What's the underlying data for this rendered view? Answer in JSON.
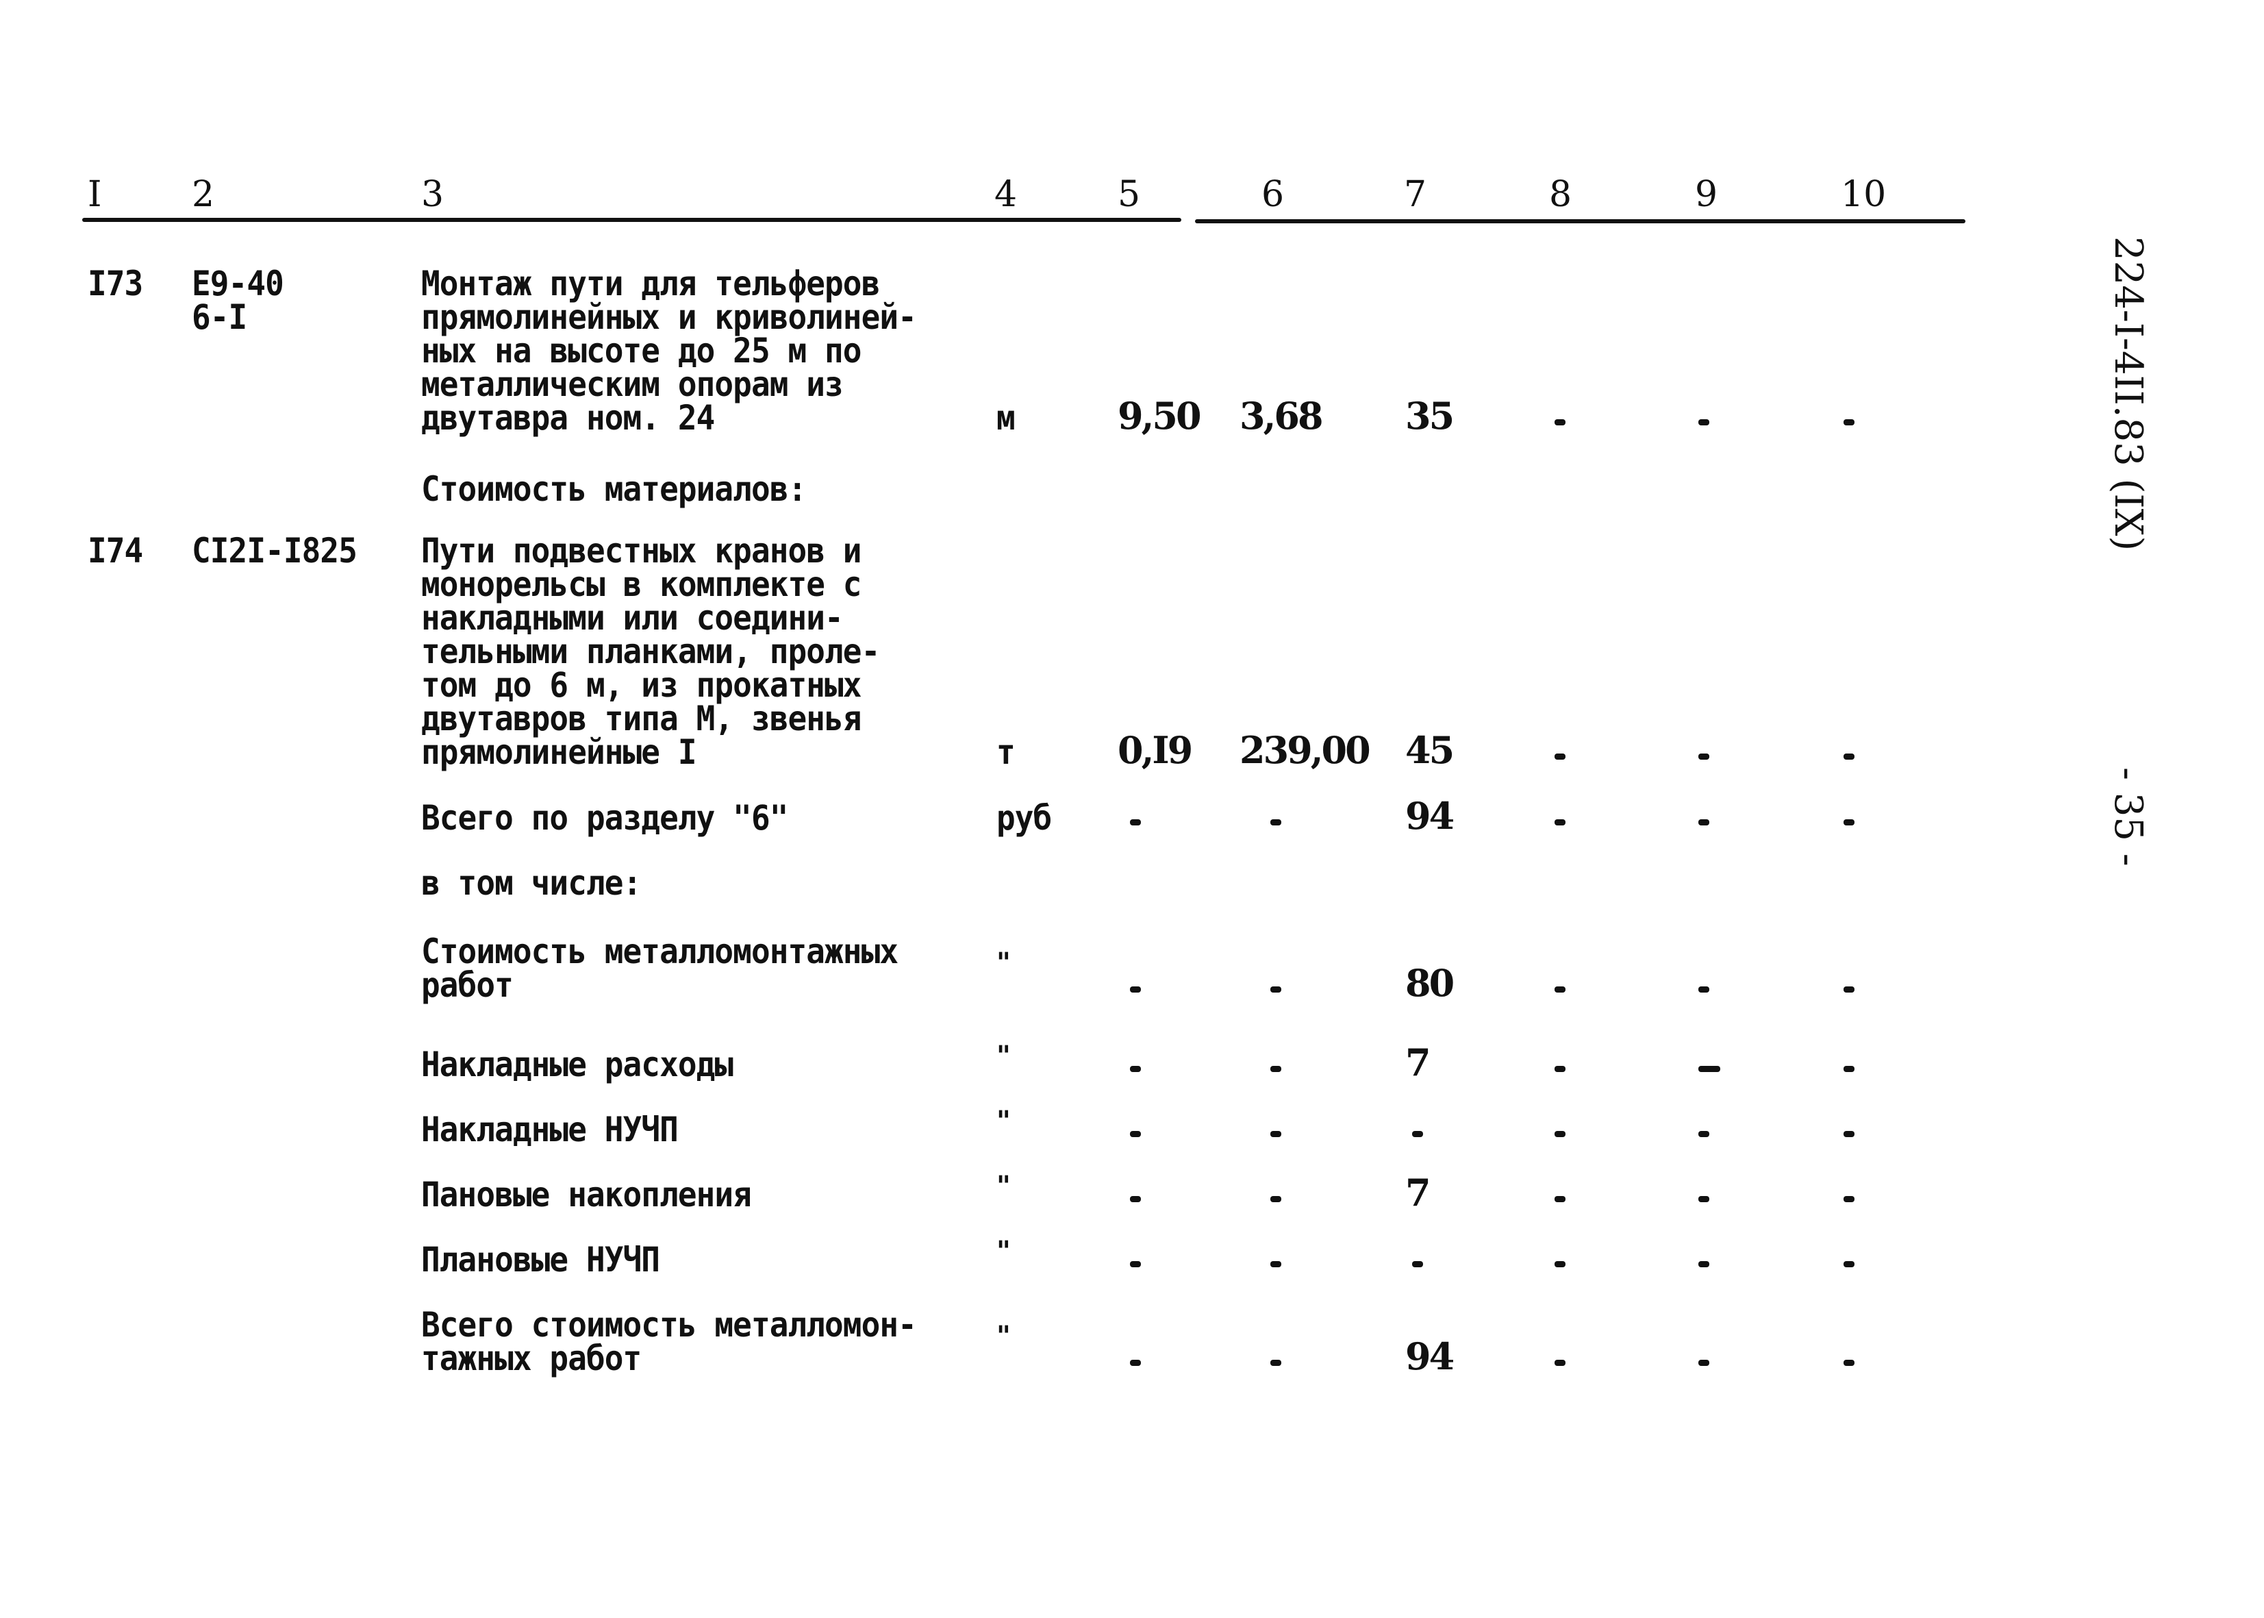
{
  "page": {
    "doc_code": "224-I-4II.83 (IX)",
    "page_number": "- 35 -"
  },
  "table": {
    "columns": [
      "I",
      "2",
      "3",
      "4",
      "5",
      "6",
      "7",
      "8",
      "9",
      "10"
    ],
    "rows": [
      {
        "num": "I73",
        "code": [
          "E9-40",
          "6-I"
        ],
        "desc": [
          "Монтаж пути для тельферов",
          "прямолинейных и криволиней-",
          "ных на высоте до 25 м по",
          "металлическим опорам из",
          "двутавра ном. 24"
        ],
        "unit": "м",
        "c5": "9,50",
        "c6": "3,68",
        "c7": "35",
        "c8": "-",
        "c9": "-",
        "c10": "-"
      },
      {
        "num": "",
        "code": [],
        "desc": [
          "Стоимость материалов:"
        ]
      },
      {
        "num": "I74",
        "code": [
          "CI2I-I825"
        ],
        "desc": [
          "Пути подвестных кранов и",
          "монорельсы в комплекте с",
          "накладными или соедини-",
          "тельными планками, проле-",
          "том до 6 м, из прокатных",
          "двутавров типа М, звенья",
          "прямолинейные I"
        ],
        "unit": "т",
        "c5": "0,I9",
        "c6": "239,00",
        "c7": "45",
        "c8": "-",
        "c9": "-",
        "c10": "-"
      },
      {
        "desc": [
          "Всего по разделу \"6\""
        ],
        "unit": "руб",
        "c5": "-",
        "c6": "-",
        "c7": "94",
        "c8": "-",
        "c9": "-",
        "c10": "-"
      },
      {
        "desc": [
          "в том числе:"
        ]
      },
      {
        "desc": [
          "Стоимость металломонтажных",
          "работ"
        ],
        "unit": "\"",
        "c5": "-",
        "c6": "-",
        "c7": "80",
        "c8": "-",
        "c9": "-",
        "c10": "-"
      },
      {
        "desc": [
          "Накладные расходы"
        ],
        "unit": "\"",
        "c5": "-",
        "c6": "-",
        "c7": "7",
        "c8": "-",
        "c9": "—",
        "c10": "-"
      },
      {
        "desc": [
          "Накладные НУЧП"
        ],
        "unit": "\"",
        "c5": "-",
        "c6": "-",
        "c7": "-",
        "c8": "-",
        "c9": "-",
        "c10": "-"
      },
      {
        "desc": [
          "Пановые накопления"
        ],
        "unit": "\"",
        "c5": "-",
        "c6": "-",
        "c7": "7",
        "c8": "-",
        "c9": "-",
        "c10": "-"
      },
      {
        "desc": [
          "Плановые НУЧП"
        ],
        "unit": "\"",
        "c5": "-",
        "c6": "-",
        "c7": "-",
        "c8": "-",
        "c9": "-",
        "c10": "-"
      },
      {
        "desc": [
          "Всего стоимость металломон-",
          "тажных работ"
        ],
        "unit": "\"",
        "c5": "-",
        "c6": "-",
        "c7": "94",
        "c8": "-",
        "c9": "-",
        "c10": "-"
      }
    ]
  }
}
